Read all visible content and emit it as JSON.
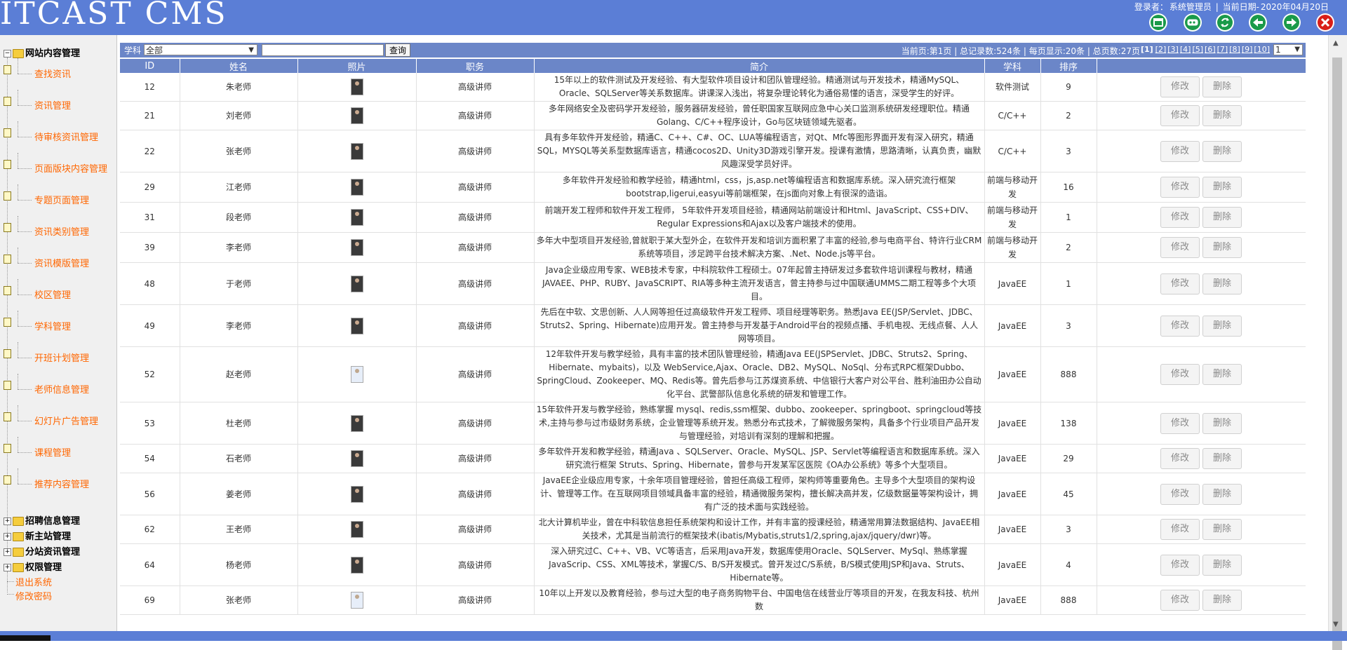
{
  "header": {
    "logo": "ITCAST CMS",
    "login_label": "登录者：",
    "login_user": "系统管理员",
    "date_label": "当前日期-",
    "date_value": "2020年04月20日",
    "icons": [
      "window-icon",
      "key-icon",
      "refresh-icon",
      "back-icon",
      "forward-icon",
      "close-icon"
    ]
  },
  "sidebar": {
    "root_label": "网站内容管理",
    "items": [
      "查找资讯",
      "资讯管理",
      "待审核资讯管理",
      "页面版块内容管理",
      "专题页面管理",
      "资讯类别管理",
      "资讯模版管理",
      "校区管理",
      "学科管理",
      "开班计划管理",
      "老师信息管理",
      "幻灯片广告管理",
      "课程管理",
      "推荐内容管理"
    ],
    "groups": [
      "招聘信息管理",
      "新主站管理",
      "分站资讯管理",
      "权限管理"
    ],
    "logout": "退出系统",
    "change_password": "修改密码"
  },
  "toolbar": {
    "subject_label": "学科",
    "subject_value": "全部",
    "search_value": "",
    "query_label": "查询",
    "page_summary": "当前页:第1页 | 总记录数:524条 | 每页显示:20条 | 总页数:27页",
    "current_page": "[1]",
    "page_links": [
      "[2]",
      "[3]",
      "[4]",
      "[5]",
      "[6]",
      "[7]",
      "[8]",
      "[9]",
      "[10]"
    ],
    "page_jump_value": "1"
  },
  "table": {
    "headers": [
      "ID",
      "姓名",
      "照片",
      "职务",
      "简介",
      "学科",
      "排序",
      ""
    ],
    "edit_label": "修改",
    "delete_label": "删除",
    "rows": [
      {
        "id": "12",
        "name": "朱老师",
        "title": "高级讲师",
        "subject": "软件测试",
        "sort": "9",
        "desc": "15年以上的软件测试及开发经验、有大型软件项目设计和团队管理经验。精通测试与开发技术，精通MySQL、Oracle、SQLServer等关系数据库。讲课深入浅出，将复杂理论转化为通俗易懂的语言，深受学生的好评。"
      },
      {
        "id": "21",
        "name": "刘老师",
        "title": "高级讲师",
        "subject": "C/C++",
        "sort": "2",
        "desc": "多年网络安全及密码学开发经验，服务器研发经验，曾任职国家互联网应急中心关口监测系统研发经理职位。精通Golang、C/C++程序设计，Go与区块链领域先驱者。"
      },
      {
        "id": "22",
        "name": "张老师",
        "title": "高级讲师",
        "subject": "C/C++",
        "sort": "3",
        "desc": "具有多年软件开发经验，精通C、C++、C#、OC、LUA等编程语言，对Qt、Mfc等图形界面开发有深入研究，精通SQL，MYSQL等关系型数据库语言，精通cocos2D、Unity3D游戏引擎开发。授课有激情，思路清晰，认真负责，幽默风趣深受学员好评。"
      },
      {
        "id": "29",
        "name": "江老师",
        "title": "高级讲师",
        "subject": "前端与移动开发",
        "sort": "16",
        "desc": "多年软件开发经验和教学经验，精通html，css，js,asp.net等编程语言和数据库系统。深入研究流行框架bootstrap,ligerui,easyui等前端框架，在js面向对象上有很深的造诣。"
      },
      {
        "id": "31",
        "name": "段老师",
        "title": "高级讲师",
        "subject": "前端与移动开发",
        "sort": "1",
        "desc": "前端开发工程师和软件开发工程师， 5年软件开发项目经验，精通网站前端设计和Html、JavaScript、CSS+DIV、Regular Expressions和Ajax以及客户端技术的使用。"
      },
      {
        "id": "39",
        "name": "李老师",
        "title": "高级讲师",
        "subject": "前端与移动开发",
        "sort": "2",
        "desc": "多年大中型项目开发经验,曾就职于某大型外企，在软件开发和培训方面积累了丰富的经验,参与电商平台、特许行业CRM系统等项目，涉足跨平台技术解决方案、.Net、Node.js等平台。"
      },
      {
        "id": "48",
        "name": "于老师",
        "title": "高级讲师",
        "subject": "JavaEE",
        "sort": "1",
        "desc": "Java企业级应用专家、WEB技术专家，中科院软件工程硕士。07年起曾主持研发过多套软件培训课程与教材，精通JAVAEE、PHP、RUBY、JavaSCRIPT、RIA等多种主流开发语言，曾主持参与过中国联通UMMS二期工程等多个大项目。"
      },
      {
        "id": "49",
        "name": "李老师",
        "title": "高级讲师",
        "subject": "JavaEE",
        "sort": "3",
        "desc": "先后在中软、文思创新、人人网等担任过高级软件开发工程师、项目经理等职务。熟悉Java EE(JSP/Servlet、JDBC、Struts2、Spring、Hibernate)应用开发。曾主持参与开发基于Android平台的视频点播、手机电视、无线点餐、人人网等项目。"
      },
      {
        "id": "52",
        "name": "赵老师",
        "title": "高级讲师",
        "subject": "JavaEE",
        "sort": "888",
        "desc": "12年软件开发与教学经验，具有丰富的技术团队管理经验，精通Java EE(JSPServlet、JDBC、Struts2、Spring、Hibernate、mybaits)，以及 WebService,Ajax、Oracle、DB2、MySQL、NoSql、分布式RPC框架Dubbo、SpringCloud、Zookeeper、MQ、Redis等。曾先后参与江苏煤资系统、中信银行大客户对公平台、胜利油田办公自动化平台、武警部队信息化系统的研发和管理工作。"
      },
      {
        "id": "53",
        "name": "杜老师",
        "title": "高级讲师",
        "subject": "JavaEE",
        "sort": "138",
        "desc": "15年软件开发与教学经验，熟练掌握 mysql、redis,ssm框架、dubbo、zookeeper、springboot、springcloud等技术,主持与参与过市级财务系统，企业管理等系统开发。熟悉分布式技术，了解微服务架构，具备多个行业项目产品开发与管理经验，对培训有深刻的理解和把握。"
      },
      {
        "id": "54",
        "name": "石老师",
        "title": "高级讲师",
        "subject": "JavaEE",
        "sort": "29",
        "desc": "多年软件开发和教学经验，精通Java 、SQLServer、Oracle、MySQL、JSP、Servlet等编程语言和数据库系统。深入研究流行框架 Struts、Spring、Hibernate，曾参与开发某军区医院《OA办公系统》等多个大型项目。"
      },
      {
        "id": "56",
        "name": "姜老师",
        "title": "高级讲师",
        "subject": "JavaEE",
        "sort": "45",
        "desc": "JavaEE企业级应用专家，十余年项目管理经验，曾担任高级工程师，架构师等重要角色。主导多个大型项目的架构设计、管理等工作。在互联网项目领域具备丰富的经验，精通微服务架构，擅长解决高并发，亿级数据量等架构设计，拥有广泛的技术面与实践经验。"
      },
      {
        "id": "62",
        "name": "王老师",
        "title": "高级讲师",
        "subject": "JavaEE",
        "sort": "3",
        "desc": "北大计算机毕业，曾在中科软信息担任系统架构和设计工作，并有丰富的授课经验，精通常用算法数据结构、JavaEE相关技术，尤其是当前流行的框架技术(ibatis/Mybatis,struts1/2,spring,ajax/jquery/dwr)等。"
      },
      {
        "id": "64",
        "name": "杨老师",
        "title": "高级讲师",
        "subject": "JavaEE",
        "sort": "4",
        "desc": "深入研究过C、C++、VB、VC等语言，后采用Java开发，数据库使用Oracle、SQLServer、MySql、熟练掌握JavaScrip、CSS、XML等技术，掌握C/S、B/S开发模式。曾开发过C/S系统，B/S模式使用JSP和Java、Struts、Hibernate等。"
      },
      {
        "id": "69",
        "name": "张老师",
        "title": "高级讲师",
        "subject": "JavaEE",
        "sort": "888",
        "desc": "10年以上开发以及教育经验，参与过大型的电子商务购物平台、中国电信在线营业厅等项目的开发，在我友科技、杭州数"
      }
    ]
  }
}
